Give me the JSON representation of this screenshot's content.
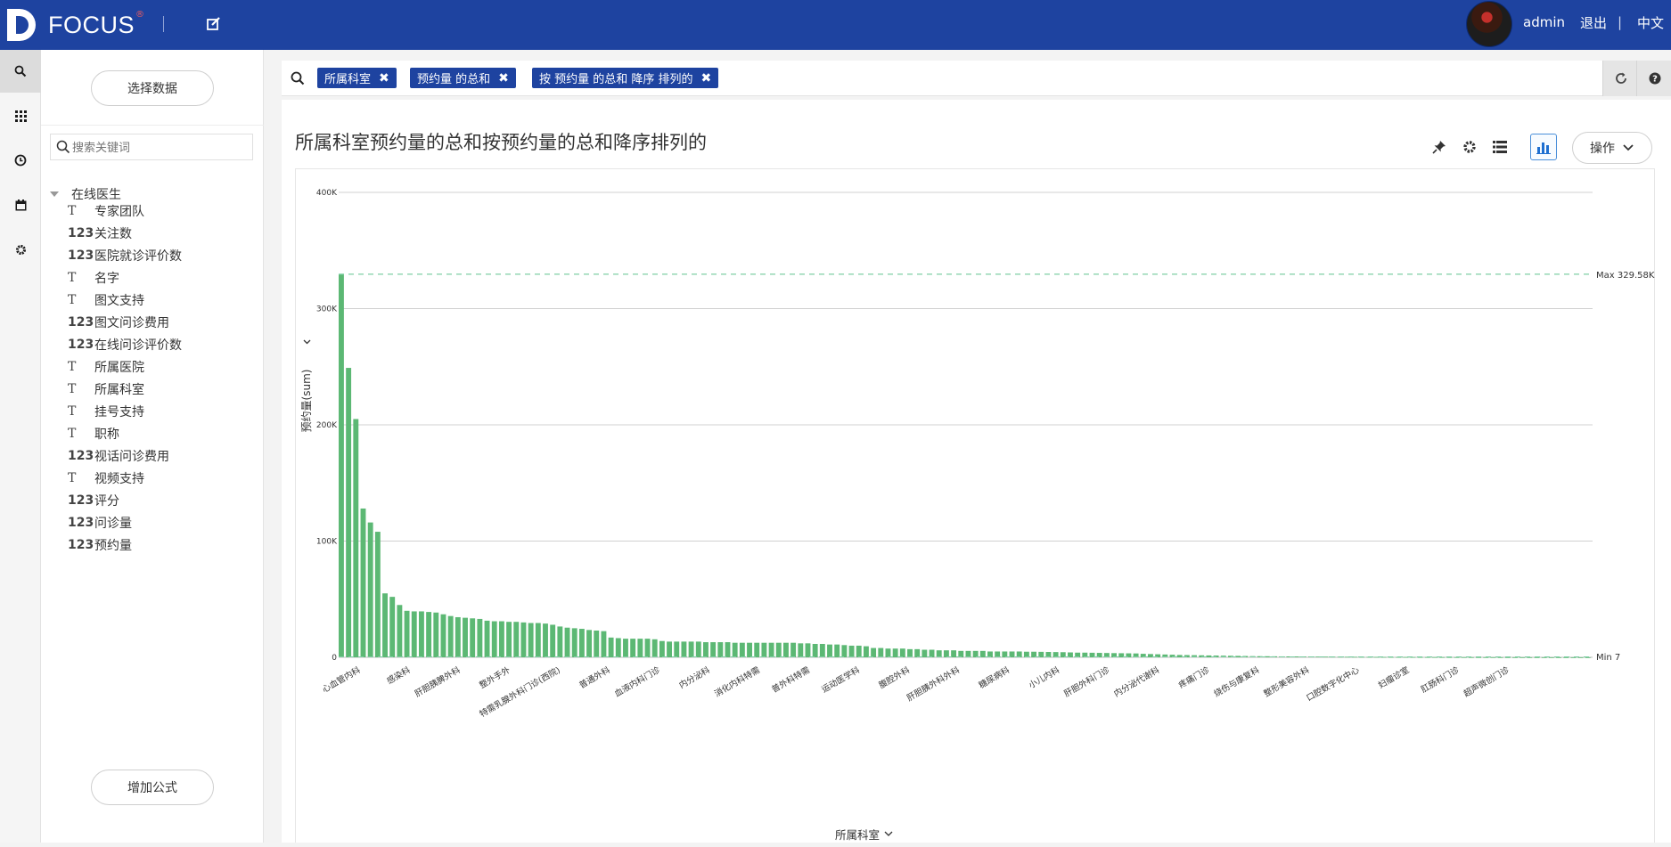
{
  "app": {
    "brand": "FOCUS",
    "brand_mark": "®",
    "user": "admin",
    "logout": "退出",
    "separator": "|",
    "language": "中文"
  },
  "rail": {
    "items": [
      "search-icon",
      "grid-icon",
      "history-icon",
      "calendar-icon",
      "gear-icon"
    ]
  },
  "panel": {
    "select_data": "选择数据",
    "search_placeholder": "搜索关键词",
    "table_name": "在线医生",
    "fields": [
      {
        "type": "T",
        "name": "专家团队"
      },
      {
        "type": "123",
        "name": "关注数"
      },
      {
        "type": "123",
        "name": "医院就诊评价数"
      },
      {
        "type": "T",
        "name": "名字"
      },
      {
        "type": "T",
        "name": "图文支持"
      },
      {
        "type": "123",
        "name": "图文问诊费用"
      },
      {
        "type": "123",
        "name": "在线问诊评价数"
      },
      {
        "type": "T",
        "name": "所属医院"
      },
      {
        "type": "T",
        "name": "所属科室"
      },
      {
        "type": "T",
        "name": "挂号支持"
      },
      {
        "type": "T",
        "name": "职称"
      },
      {
        "type": "123",
        "name": "视话问诊费用"
      },
      {
        "type": "T",
        "name": "视频支持"
      },
      {
        "type": "123",
        "name": "评分"
      },
      {
        "type": "123",
        "name": "问诊量"
      },
      {
        "type": "123",
        "name": "预约量"
      }
    ],
    "add_formula": "增加公式"
  },
  "query": {
    "chips": [
      "所属科室",
      "预约量 的总和",
      "按 预约量 的总和 降序 排列的"
    ]
  },
  "card": {
    "title": "所属科室预约量的总和按预约量的总和降序排列的",
    "ops_label": "操作"
  },
  "colors": {
    "brand": "#1e43a0",
    "bar": "#5cb874",
    "max_line": "#7ecfa4"
  },
  "chart_data": {
    "type": "bar",
    "xlabel": "所属科室",
    "ylabel": "预约量(sum)",
    "ylim": [
      0,
      400000
    ],
    "yticks": [
      {
        "value": 0,
        "label": "0"
      },
      {
        "value": 100000,
        "label": "100K"
      },
      {
        "value": 200000,
        "label": "200K"
      },
      {
        "value": 300000,
        "label": "300K"
      },
      {
        "value": 400000,
        "label": "400K"
      }
    ],
    "max_label": "Max 329.58K",
    "min_label": "Min 7",
    "max_value": 329580,
    "min_value": 7,
    "visible_category_labels": [
      "心血管内科",
      "感染科",
      "肝胆胰脾外科",
      "整外手外",
      "特需乳腺外科门诊(西院)",
      "普通外科",
      "血液内科门诊",
      "内分泌科",
      "消化内科特需",
      "普外科特需",
      "运动医学科",
      "腹腔外科",
      "肝胆胰外科外科",
      "糖尿病科",
      "小儿内科",
      "肝胆外科门诊",
      "内分泌代谢科",
      "疼痛门诊",
      "烧伤与康复科",
      "整形美容外科",
      "口腔数字化中心",
      "妇瘤诊室",
      "肛肠科门诊",
      "超声微创门诊"
    ],
    "values": [
      329580,
      249000,
      205000,
      128000,
      116000,
      108000,
      55000,
      52000,
      45000,
      40000,
      39500,
      39500,
      39000,
      38500,
      37000,
      35500,
      34500,
      34000,
      33500,
      33000,
      31500,
      31000,
      31000,
      30500,
      30500,
      30000,
      29500,
      29500,
      29000,
      28000,
      26500,
      25500,
      25000,
      24500,
      23500,
      23000,
      22500,
      17000,
      16500,
      16000,
      16000,
      16000,
      16000,
      15500,
      14000,
      13500,
      13500,
      13500,
      13500,
      13500,
      13000,
      13000,
      13000,
      13000,
      12500,
      12500,
      12500,
      12500,
      12500,
      12500,
      12500,
      12500,
      12500,
      12000,
      12000,
      11500,
      11500,
      11000,
      11000,
      10500,
      10000,
      10000,
      9500,
      8000,
      8000,
      7500,
      7500,
      7500,
      7000,
      7000,
      6500,
      6500,
      6000,
      6000,
      6000,
      5500,
      5500,
      5500,
      5500,
      5000,
      5000,
      5000,
      5000,
      5000,
      4800,
      4800,
      4700,
      4600,
      4500,
      4400,
      4200,
      4000,
      4000,
      3900,
      3800,
      3700,
      3600,
      3500,
      3400,
      3300,
      3000,
      2800,
      2600,
      2400,
      2200,
      2000,
      1900,
      1800,
      1700,
      1600,
      1500,
      1400,
      1300,
      1200,
      1100,
      1000,
      950,
      900,
      850,
      800,
      760,
      720,
      680,
      640,
      600,
      560,
      520,
      480,
      450,
      420,
      390,
      360,
      330,
      300,
      280,
      260,
      240,
      220,
      200,
      185,
      170,
      155,
      140,
      125,
      110,
      100,
      90,
      80,
      70,
      62,
      55,
      48,
      42,
      36,
      30,
      25,
      20,
      16,
      13,
      10,
      8,
      7
    ]
  }
}
